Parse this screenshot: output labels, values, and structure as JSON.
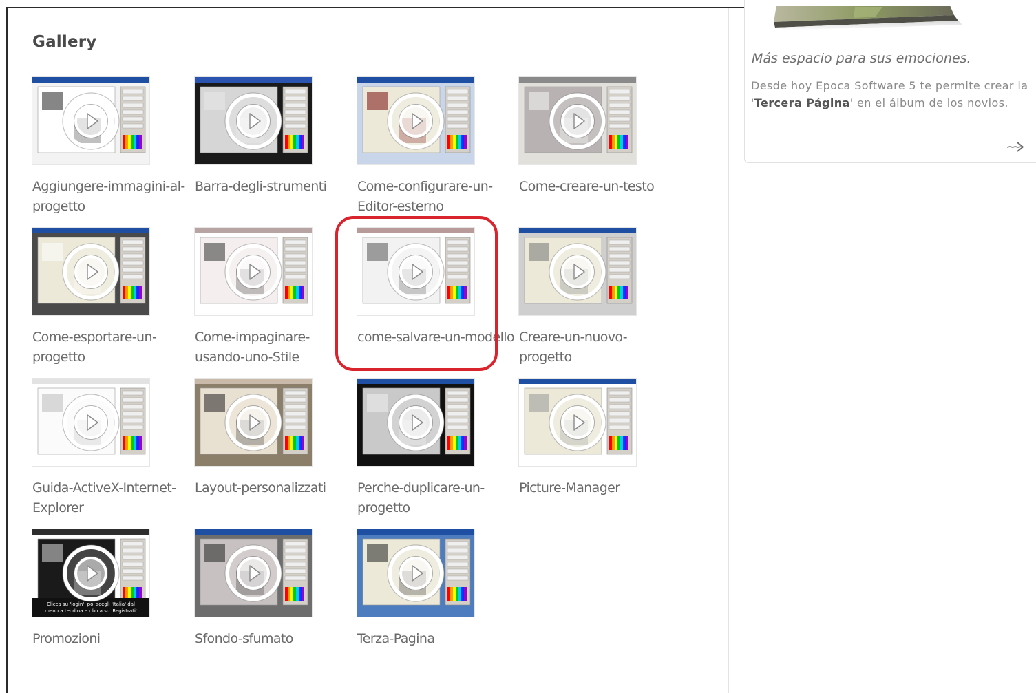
{
  "gallery": {
    "title": "Gallery",
    "items": [
      {
        "label": "Aggiungere-immagini-al-progetto",
        "icon": "video-play-icon"
      },
      {
        "label": "Barra-degli-strumenti",
        "icon": "video-play-icon"
      },
      {
        "label": "Come-configurare-un-Editor-esterno",
        "icon": "video-play-icon"
      },
      {
        "label": "Come-creare-un-testo",
        "icon": "video-play-icon"
      },
      {
        "label": "Come-esportare-un-progetto",
        "icon": "video-play-icon"
      },
      {
        "label": "Come-impaginare-usando-uno-Stile",
        "icon": "video-play-icon"
      },
      {
        "label": "come-salvare-un-modello",
        "icon": "video-play-icon",
        "highlighted": true
      },
      {
        "label": "Creare-un-nuovo-progetto",
        "icon": "video-play-icon"
      },
      {
        "label": "Guida-ActiveX-Internet-Explorer",
        "icon": "video-play-icon"
      },
      {
        "label": "Layout-personalizzati",
        "icon": "video-play-icon"
      },
      {
        "label": "Perche-duplicare-un-progetto",
        "icon": "video-play-icon"
      },
      {
        "label": "Picture-Manager",
        "icon": "video-play-icon"
      },
      {
        "label": "Promozioni",
        "icon": "video-play-icon",
        "thumb_caption_line1": "Clicca su 'login', poi scegli 'Italia' dal",
        "thumb_caption_line2": "menu a tendina e clicca su 'Registrati'"
      },
      {
        "label": "Sfondo-sfumato",
        "icon": "video-play-icon"
      },
      {
        "label": "Terza-Pagina",
        "icon": "video-play-icon"
      }
    ]
  },
  "promo": {
    "headline": "Más espacio para sus emociones.",
    "body_before": "Desde hoy Epoca Software 5 te permite crear la '",
    "body_bold": "Tercera Página",
    "body_after": "' en el álbum de los novios.",
    "arrow_icon": "arrow-right-icon"
  },
  "colors": {
    "highlight": "#d9232d",
    "caption_text": "#6a6a6a",
    "title_text": "#4a4a4a"
  }
}
